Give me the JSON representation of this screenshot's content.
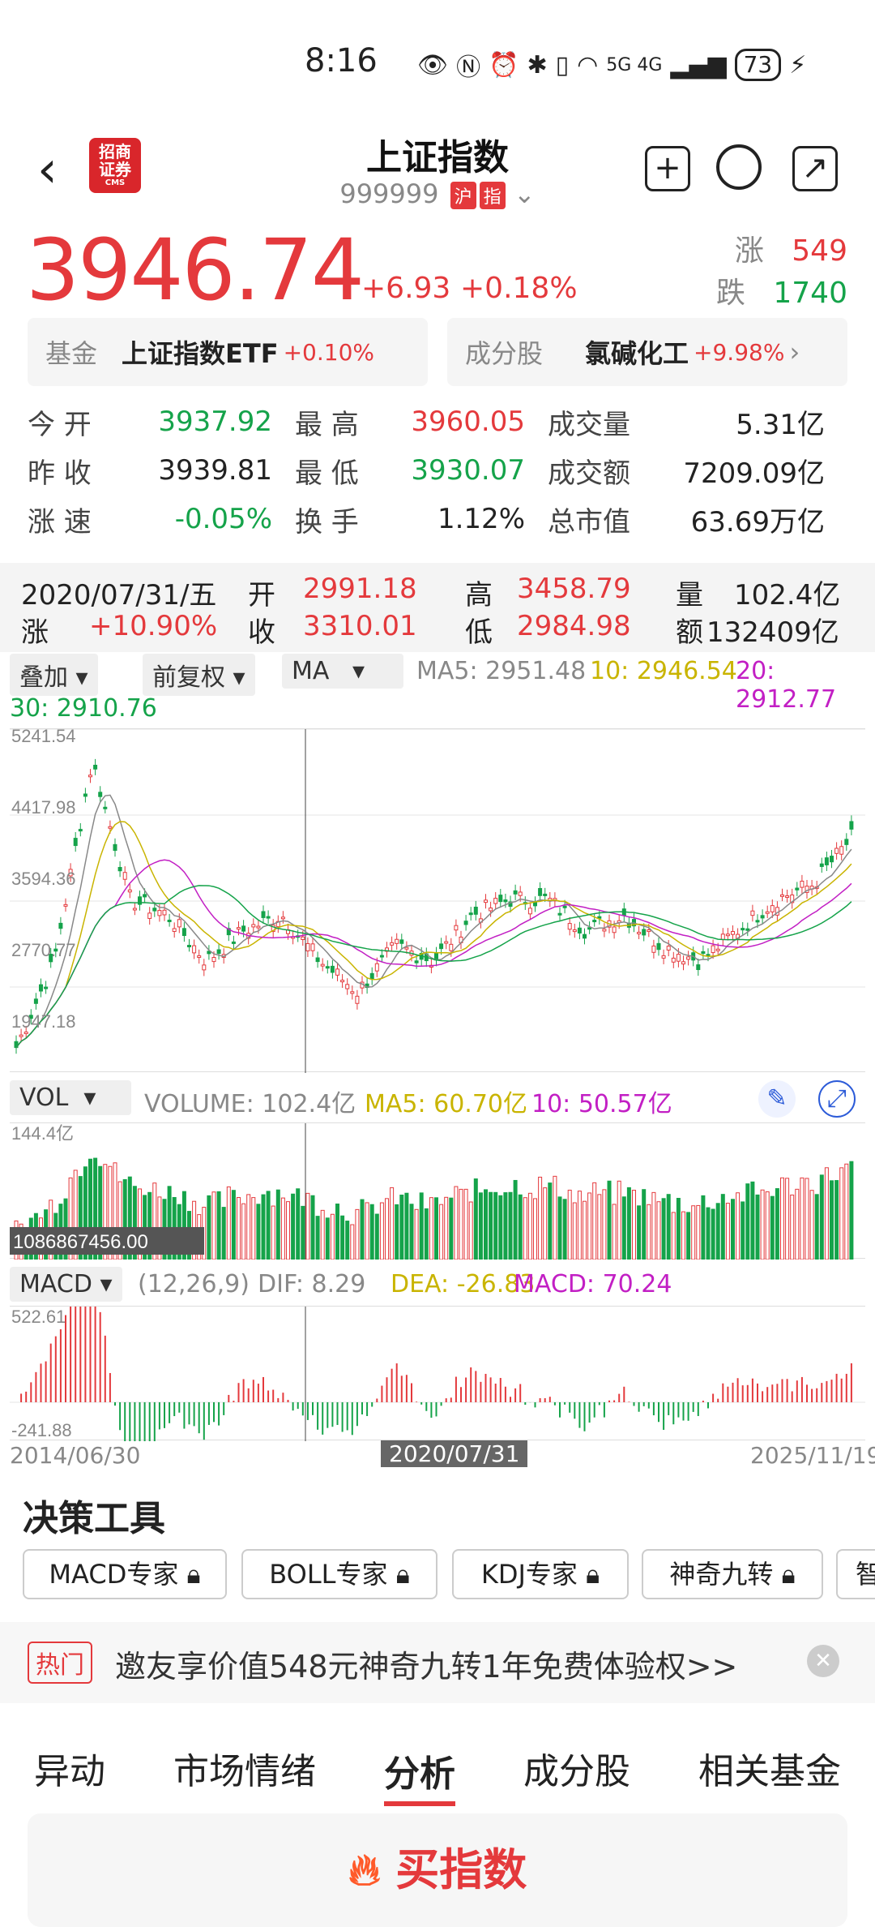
{
  "status": {
    "time": "8:16",
    "battery": "73",
    "net": "5G 4G"
  },
  "header": {
    "title": "上证指数",
    "code": "999999",
    "tag1": "沪",
    "tag2": "指",
    "logo": "招商证券",
    "logo_sub": "CMS"
  },
  "quote": {
    "price": "3946.74",
    "change": "+6.93",
    "change_pct": "+0.18%",
    "up_label": "涨",
    "up_count": "549",
    "down_label": "跌",
    "down_count": "1740"
  },
  "pills": {
    "fund_label": "基金",
    "fund_name": "上证指数ETF",
    "fund_pct": "+0.10%",
    "comp_label": "成分股",
    "comp_name": "氯碱化工",
    "comp_pct": "+9.98%"
  },
  "stats": [
    [
      {
        "l": "今  开",
        "v": "3937.92",
        "c": "green"
      },
      {
        "l": "最  高",
        "v": "3960.05",
        "c": "red"
      },
      {
        "l": "成交量",
        "v": "5.31亿",
        "c": ""
      }
    ],
    [
      {
        "l": "昨  收",
        "v": "3939.81",
        "c": ""
      },
      {
        "l": "最  低",
        "v": "3930.07",
        "c": "green"
      },
      {
        "l": "成交额",
        "v": "7209.09亿",
        "c": ""
      }
    ],
    [
      {
        "l": "涨  速",
        "v": "-0.05%",
        "c": "green"
      },
      {
        "l": "换  手",
        "v": "1.12%",
        "c": ""
      },
      {
        "l": "总市值",
        "v": "63.69万亿",
        "c": ""
      }
    ]
  ],
  "day": {
    "date": "2020/07/31/五",
    "open_l": "开",
    "open": "2991.18",
    "high_l": "高",
    "high": "3458.79",
    "vol_l": "量",
    "vol": "102.4亿",
    "chg_l": "涨",
    "chg": "+10.90%",
    "close_l": "收",
    "close": "3310.01",
    "low_l": "低",
    "low": "2984.98",
    "amt_l": "额",
    "amt": "132409亿"
  },
  "controls": {
    "overlay": "叠加",
    "adjust": "前复权",
    "ma": "MA",
    "ma5": "MA5: 2951.48",
    "ma10": "10: 2946.54",
    "ma20": "20: 2912.77",
    "ma30": "30: 2910.76"
  },
  "kline": {
    "ticks": [
      "5241.54",
      "4417.98",
      "3594.36",
      "2770.77",
      "1947.18"
    ]
  },
  "vol": {
    "sel": "VOL",
    "volume": "VOLUME: 102.4亿",
    "ma5": "MA5: 60.70亿",
    "ma10": "10: 50.57亿",
    "max": "144.4亿",
    "cursor": "1086867456.00"
  },
  "macd": {
    "sel": "MACD",
    "params": "(12,26,9)",
    "dif": "DIF: 8.29",
    "dea": "DEA: -26.83",
    "macd": "MACD: 70.24",
    "max": "522.61",
    "min": "-241.88",
    "start": "2014/06/30",
    "cursor_date": "2020/07/31",
    "end": "2025/11/19"
  },
  "tools": {
    "title": "决策工具",
    "items": [
      "MACD专家",
      "BOLL专家",
      "KDJ专家",
      "神奇九转",
      "智"
    ]
  },
  "banner": {
    "tag": "热门",
    "text": "邀友享价值548元神奇九转1年免费体验权>>"
  },
  "tabs": [
    "异动",
    "市场情绪",
    "分析",
    "成分股",
    "相关基金"
  ],
  "buy": "买指数",
  "colors": {
    "red": "#e4393c",
    "green": "#15a34a",
    "ma10": "#c9b400",
    "ma20": "#c21fc4"
  }
}
